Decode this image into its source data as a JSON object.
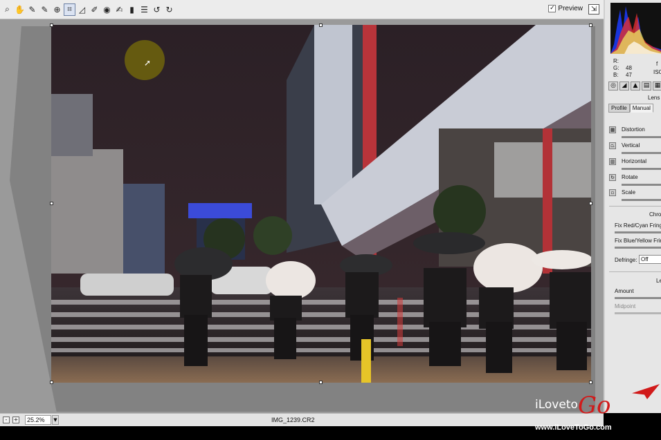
{
  "toolbar": {
    "tools": [
      {
        "name": "zoom-tool-icon",
        "glyph": "⌕"
      },
      {
        "name": "hand-tool-icon",
        "glyph": "✋"
      },
      {
        "name": "white-balance-tool-icon",
        "glyph": "✎"
      },
      {
        "name": "color-sampler-tool-icon",
        "glyph": "✎"
      },
      {
        "name": "targeted-adjustment-tool-icon",
        "glyph": "⊕"
      },
      {
        "name": "crop-tool-icon",
        "glyph": "⌗"
      },
      {
        "name": "straighten-tool-icon",
        "glyph": "◿"
      },
      {
        "name": "spot-removal-tool-icon",
        "glyph": "✐"
      },
      {
        "name": "red-eye-tool-icon",
        "glyph": "◉"
      },
      {
        "name": "adjustment-brush-icon",
        "glyph": "✍"
      },
      {
        "name": "graduated-filter-icon",
        "glyph": "▮"
      },
      {
        "name": "preferences-icon",
        "glyph": "☰"
      },
      {
        "name": "rotate-left-icon",
        "glyph": "↺"
      },
      {
        "name": "rotate-right-icon",
        "glyph": "↻"
      }
    ],
    "preview_label": "Preview",
    "preview_checked": "✓",
    "fullscreen_glyph": "⇲"
  },
  "status": {
    "zoom_minus": "-",
    "zoom_plus": "+",
    "zoom_value": "25.2%",
    "zoom_drop": "▼",
    "filename": "IMG_1239.CR2"
  },
  "panel": {
    "rgb_labels": "R:\nG:\nB:",
    "rgb_values": "\n48\n47",
    "iso": "ISO",
    "iso_value": "f",
    "tab_glyphs": [
      "◎",
      "◢",
      "▲",
      "▤",
      "▦"
    ],
    "title": "Lens",
    "subtabs": [
      "Profile",
      "Manual"
    ],
    "sliders": [
      "Distortion",
      "Vertical",
      "Horizontal",
      "Rotate",
      "Scale"
    ],
    "chromatic_title": "Chrom",
    "fix_red_cyan": "Fix Red/Cyan Fringe",
    "fix_blue_yellow": "Fix Blue/Yellow Fring",
    "defringe_label": "Defringe:",
    "defringe_value": "Off",
    "vignette_title": "Le",
    "amount_label": "Amount",
    "midpoint_label": "Midpoint"
  },
  "watermark": {
    "brand_prefix": "iLoveto",
    "brand_go": "Go",
    "url": "www.iLoveToGo.com"
  }
}
